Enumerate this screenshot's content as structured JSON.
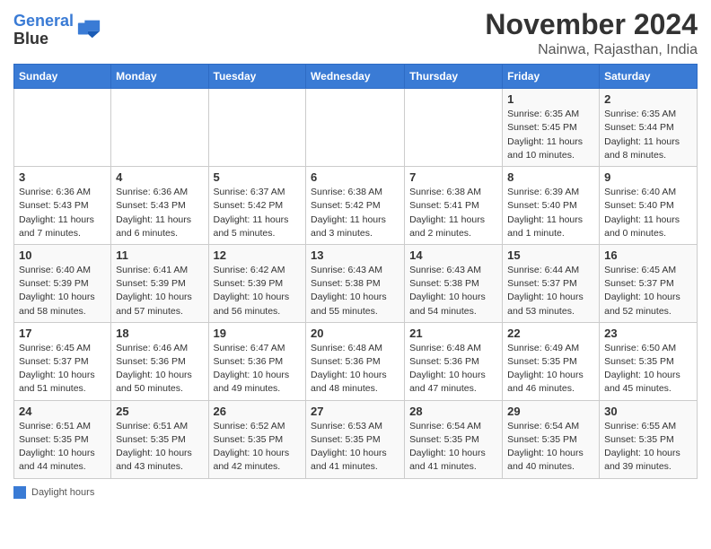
{
  "logo": {
    "line1": "General",
    "line2": "Blue"
  },
  "title": "November 2024",
  "location": "Nainwa, Rajasthan, India",
  "days_header": [
    "Sunday",
    "Monday",
    "Tuesday",
    "Wednesday",
    "Thursday",
    "Friday",
    "Saturday"
  ],
  "weeks": [
    [
      {
        "num": "",
        "info": ""
      },
      {
        "num": "",
        "info": ""
      },
      {
        "num": "",
        "info": ""
      },
      {
        "num": "",
        "info": ""
      },
      {
        "num": "",
        "info": ""
      },
      {
        "num": "1",
        "info": "Sunrise: 6:35 AM\nSunset: 5:45 PM\nDaylight: 11 hours and 10 minutes."
      },
      {
        "num": "2",
        "info": "Sunrise: 6:35 AM\nSunset: 5:44 PM\nDaylight: 11 hours and 8 minutes."
      }
    ],
    [
      {
        "num": "3",
        "info": "Sunrise: 6:36 AM\nSunset: 5:43 PM\nDaylight: 11 hours and 7 minutes."
      },
      {
        "num": "4",
        "info": "Sunrise: 6:36 AM\nSunset: 5:43 PM\nDaylight: 11 hours and 6 minutes."
      },
      {
        "num": "5",
        "info": "Sunrise: 6:37 AM\nSunset: 5:42 PM\nDaylight: 11 hours and 5 minutes."
      },
      {
        "num": "6",
        "info": "Sunrise: 6:38 AM\nSunset: 5:42 PM\nDaylight: 11 hours and 3 minutes."
      },
      {
        "num": "7",
        "info": "Sunrise: 6:38 AM\nSunset: 5:41 PM\nDaylight: 11 hours and 2 minutes."
      },
      {
        "num": "8",
        "info": "Sunrise: 6:39 AM\nSunset: 5:40 PM\nDaylight: 11 hours and 1 minute."
      },
      {
        "num": "9",
        "info": "Sunrise: 6:40 AM\nSunset: 5:40 PM\nDaylight: 11 hours and 0 minutes."
      }
    ],
    [
      {
        "num": "10",
        "info": "Sunrise: 6:40 AM\nSunset: 5:39 PM\nDaylight: 10 hours and 58 minutes."
      },
      {
        "num": "11",
        "info": "Sunrise: 6:41 AM\nSunset: 5:39 PM\nDaylight: 10 hours and 57 minutes."
      },
      {
        "num": "12",
        "info": "Sunrise: 6:42 AM\nSunset: 5:39 PM\nDaylight: 10 hours and 56 minutes."
      },
      {
        "num": "13",
        "info": "Sunrise: 6:43 AM\nSunset: 5:38 PM\nDaylight: 10 hours and 55 minutes."
      },
      {
        "num": "14",
        "info": "Sunrise: 6:43 AM\nSunset: 5:38 PM\nDaylight: 10 hours and 54 minutes."
      },
      {
        "num": "15",
        "info": "Sunrise: 6:44 AM\nSunset: 5:37 PM\nDaylight: 10 hours and 53 minutes."
      },
      {
        "num": "16",
        "info": "Sunrise: 6:45 AM\nSunset: 5:37 PM\nDaylight: 10 hours and 52 minutes."
      }
    ],
    [
      {
        "num": "17",
        "info": "Sunrise: 6:45 AM\nSunset: 5:37 PM\nDaylight: 10 hours and 51 minutes."
      },
      {
        "num": "18",
        "info": "Sunrise: 6:46 AM\nSunset: 5:36 PM\nDaylight: 10 hours and 50 minutes."
      },
      {
        "num": "19",
        "info": "Sunrise: 6:47 AM\nSunset: 5:36 PM\nDaylight: 10 hours and 49 minutes."
      },
      {
        "num": "20",
        "info": "Sunrise: 6:48 AM\nSunset: 5:36 PM\nDaylight: 10 hours and 48 minutes."
      },
      {
        "num": "21",
        "info": "Sunrise: 6:48 AM\nSunset: 5:36 PM\nDaylight: 10 hours and 47 minutes."
      },
      {
        "num": "22",
        "info": "Sunrise: 6:49 AM\nSunset: 5:35 PM\nDaylight: 10 hours and 46 minutes."
      },
      {
        "num": "23",
        "info": "Sunrise: 6:50 AM\nSunset: 5:35 PM\nDaylight: 10 hours and 45 minutes."
      }
    ],
    [
      {
        "num": "24",
        "info": "Sunrise: 6:51 AM\nSunset: 5:35 PM\nDaylight: 10 hours and 44 minutes."
      },
      {
        "num": "25",
        "info": "Sunrise: 6:51 AM\nSunset: 5:35 PM\nDaylight: 10 hours and 43 minutes."
      },
      {
        "num": "26",
        "info": "Sunrise: 6:52 AM\nSunset: 5:35 PM\nDaylight: 10 hours and 42 minutes."
      },
      {
        "num": "27",
        "info": "Sunrise: 6:53 AM\nSunset: 5:35 PM\nDaylight: 10 hours and 41 minutes."
      },
      {
        "num": "28",
        "info": "Sunrise: 6:54 AM\nSunset: 5:35 PM\nDaylight: 10 hours and 41 minutes."
      },
      {
        "num": "29",
        "info": "Sunrise: 6:54 AM\nSunset: 5:35 PM\nDaylight: 10 hours and 40 minutes."
      },
      {
        "num": "30",
        "info": "Sunrise: 6:55 AM\nSunset: 5:35 PM\nDaylight: 10 hours and 39 minutes."
      }
    ]
  ],
  "footer": {
    "box_color": "#3a7bd5",
    "label": "Daylight hours"
  }
}
